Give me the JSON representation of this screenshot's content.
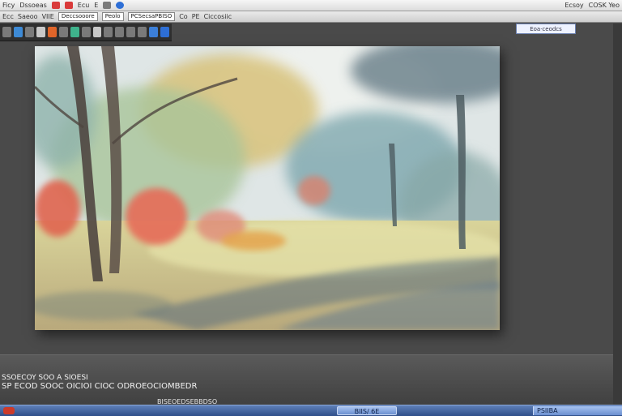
{
  "menu": {
    "items": [
      "Ficy",
      "Dssoeas",
      "Ecu",
      "E"
    ],
    "items_right": [
      "Ecsoy",
      "COSK Yeo"
    ],
    "colors": {
      "red": "#d93a3a",
      "blue": "#2e6fd6",
      "grey": "#7b7b7b"
    }
  },
  "options": {
    "items": [
      "Ecc",
      "Saeoo",
      "VIIE"
    ],
    "field1": "Deccsooore",
    "field2": "Peolo",
    "field3": "PCSecsaPBISO",
    "items_right": [
      "Co",
      "PE",
      "Ciccosiic"
    ]
  },
  "panel_chip": {
    "label": "Eoa·ceodcs"
  },
  "canvas": {
    "palette": {
      "sky": "#dfe6e6",
      "foliage_yellow": "#d8c27a",
      "foliage_teal": "#6f9ea6",
      "foliage_red": "#e0654f",
      "grass": "#c9c58c",
      "shadow": "#5a6d7d",
      "trunk": "#4f4640"
    }
  },
  "status": {
    "line1": "SSOECOY SOO A SIOESI",
    "line2": "SP ECOD SOOC OICIOI CIOC ODROEOCIOMBEDR",
    "line3": "BISEOEDSEBBDSO"
  },
  "taskbar": {
    "app_label": "BIIS/ 6E",
    "tray_label": "PSIIBA"
  }
}
